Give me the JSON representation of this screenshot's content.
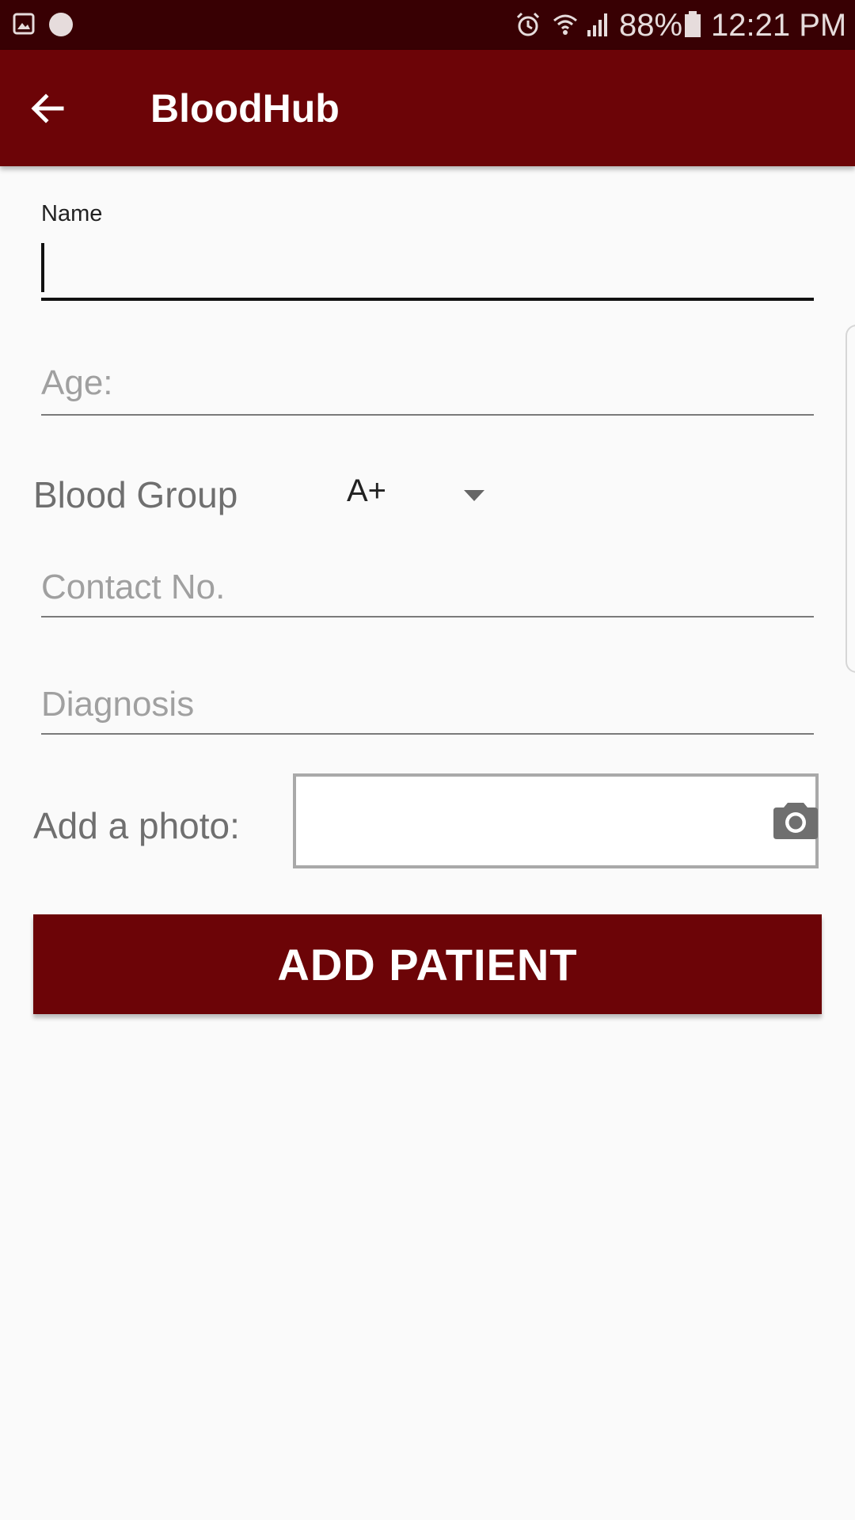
{
  "status_bar": {
    "battery_percent": "88%",
    "time": "12:21 PM",
    "left_icons": [
      "image-icon",
      "circle-notification-icon"
    ],
    "right_icons": [
      "alarm-icon",
      "wifi-icon",
      "signal-icon",
      "battery-icon"
    ]
  },
  "app_bar": {
    "title": "BloodHub",
    "back_icon": "arrow-back-icon",
    "color": "#6c0407"
  },
  "form": {
    "name": {
      "label": "Name",
      "value": ""
    },
    "age": {
      "placeholder": "Age:",
      "value": ""
    },
    "blood_group": {
      "label": "Blood Group",
      "selected": "A+"
    },
    "contact": {
      "placeholder": "Contact No.",
      "value": ""
    },
    "diagnosis": {
      "placeholder": "Diagnosis",
      "value": ""
    },
    "photo": {
      "label": "Add a photo:",
      "icon": "camera-icon"
    },
    "submit_label": "ADD PATIENT"
  },
  "colors": {
    "status_bar": "#380003",
    "primary": "#6c0407",
    "background": "#fafafa"
  }
}
